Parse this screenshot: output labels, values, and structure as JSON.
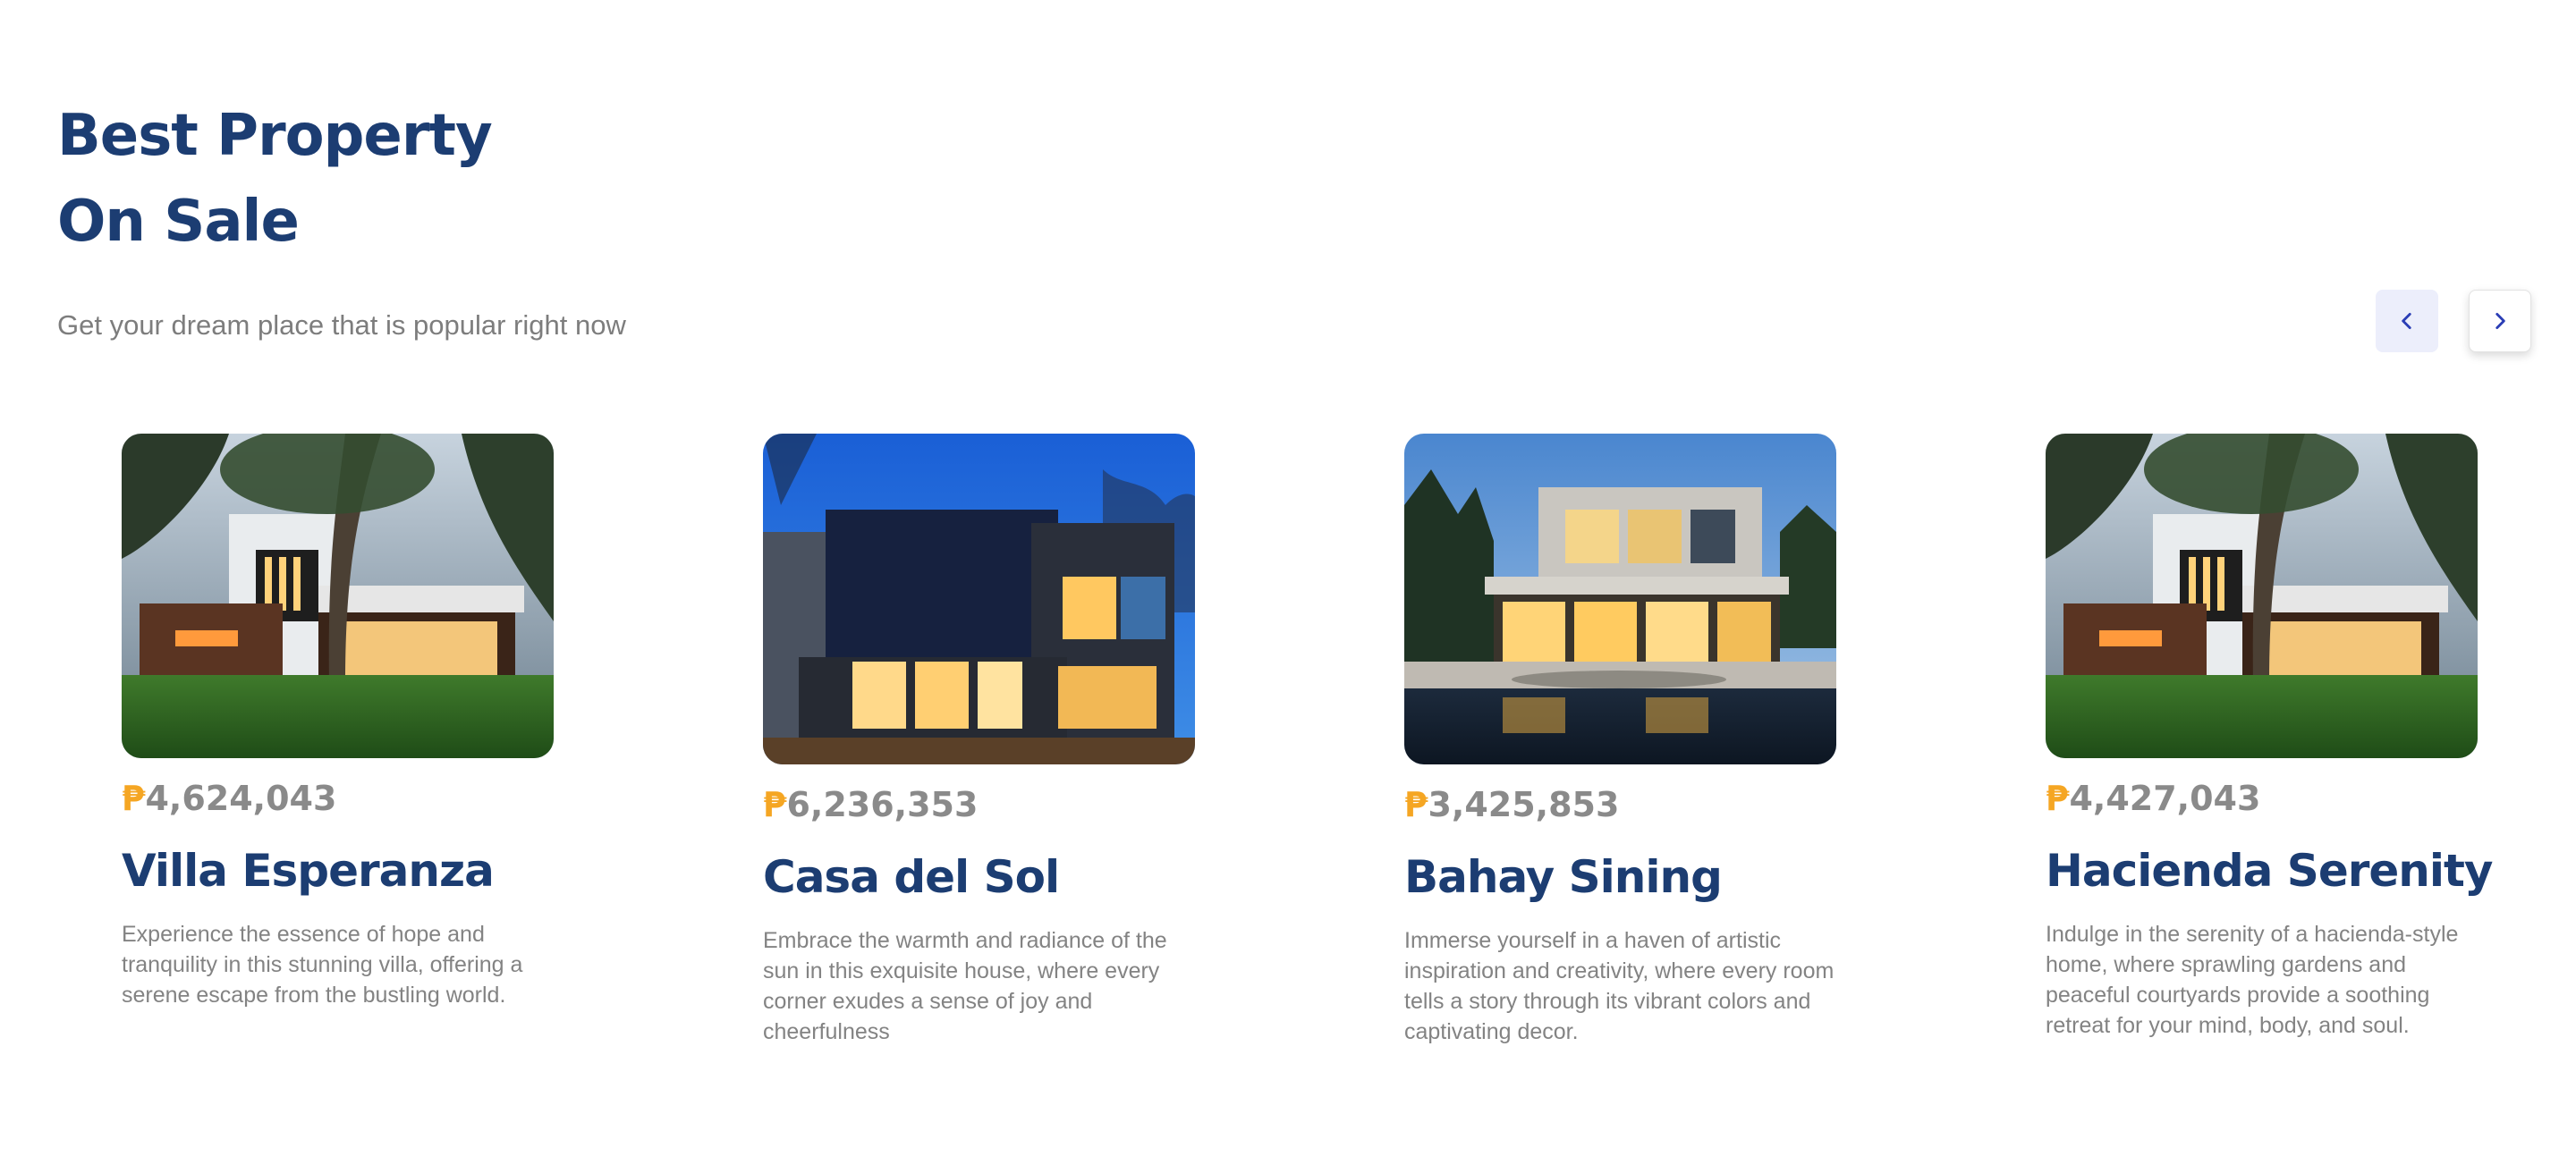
{
  "header": {
    "title_line1": "Best Property",
    "title_line2": "On Sale",
    "subtitle": "Get your dream place that is popular right now"
  },
  "navigation": {
    "prev_icon": "chevron-left-icon",
    "next_icon": "chevron-right-icon"
  },
  "colors": {
    "heading": "#1c3d72",
    "currency": "#f5a623",
    "price": "#8a8a8a",
    "description": "#838383",
    "nav_prev_bg": "#eceefb",
    "nav_arrow": "#2a3db5"
  },
  "properties": [
    {
      "currency": "₱",
      "price": "4,624,043",
      "name": "Villa Esperanza",
      "description": "Experience the essence of hope and tranquility in this stunning villa, offering a serene escape from the bustling world."
    },
    {
      "currency": "₱",
      "price": "6,236,353",
      "name": "Casa del Sol",
      "description": "Embrace the warmth and radiance of the sun in this exquisite house, where every corner exudes a sense of joy and cheerfulness"
    },
    {
      "currency": "₱",
      "price": "3,425,853",
      "name": "Bahay Sining",
      "description": "Immerse yourself in a haven of artistic inspiration and creativity, where every room tells a story through its vibrant colors and captivating decor."
    },
    {
      "currency": "₱",
      "price": "4,427,043",
      "name": "Hacienda Serenity",
      "description": "Indulge in the serenity of a hacienda-style home, where sprawling gardens and peaceful courtyards provide a soothing retreat for your mind, body, and soul."
    }
  ]
}
